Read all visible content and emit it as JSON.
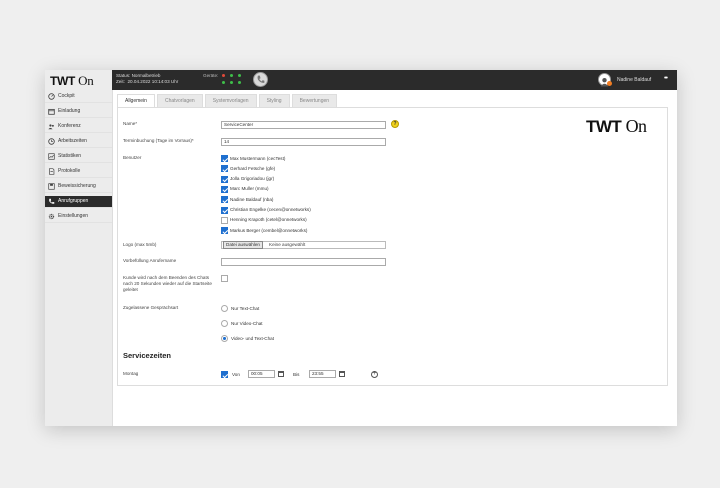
{
  "sidebar": {
    "logo_main": "TWT",
    "logo_suffix": "On",
    "items": [
      {
        "label": "Cockpit",
        "icon": "dashboard-icon"
      },
      {
        "label": "Einladung",
        "icon": "calendar-icon"
      },
      {
        "label": "Konferenz",
        "icon": "people-icon"
      },
      {
        "label": "Arbeitszeiten",
        "icon": "clock-icon"
      },
      {
        "label": "Statistiken",
        "icon": "chart-icon"
      },
      {
        "label": "Protokolle",
        "icon": "log-icon"
      },
      {
        "label": "Beweissicherung",
        "icon": "save-icon"
      },
      {
        "label": "Anrufgruppen",
        "icon": "phone-icon",
        "active": true
      },
      {
        "label": "Einstellungen",
        "icon": "gear-icon"
      }
    ]
  },
  "topbar": {
    "status_label": "Status:",
    "status_value": "Normalbetrieb",
    "time_label": "Zeit:",
    "time_value": "20.04.2022 10:14:03 Uhr",
    "devices_label": "Geräte:",
    "user_name": "Nadine Baldauf",
    "more": "••"
  },
  "tabs": [
    "Allgemein",
    "Chatvorlagen",
    "Systemvorlagen",
    "Styling",
    "Bewertungen"
  ],
  "form": {
    "name_label": "Name*",
    "name_value": "ServiceCenter",
    "booking_label": "Terminbuchung (Tage im Vorraus)*",
    "booking_value": "14",
    "users_label": "Benutzer",
    "users": [
      {
        "name": "Max Mustermann (cecTest)",
        "checked": true
      },
      {
        "name": "Gerhard Fetsche (gfe)",
        "checked": true
      },
      {
        "name": "Jolla Grigoriadou (jgr)",
        "checked": true
      },
      {
        "name": "Marc Muller (mmu)",
        "checked": true
      },
      {
        "name": "Nadine Baldauf (nba)",
        "checked": true
      },
      {
        "name": "Christian Engelke (cecen@onnetworks)",
        "checked": true
      },
      {
        "name": "Henning Krapoth (cetel@onnetworks)",
        "checked": false
      },
      {
        "name": "Markus Berger (cembel@onnetworks)",
        "checked": true
      }
    ],
    "logo_label": "Logo (max 5mb)",
    "file_button": "Datei auswählen",
    "file_status": "Keine ausgewählt",
    "prefill_label": "Vorbefüllung Anrufername",
    "prefill_value": "",
    "redirect_label": "Kunde wird nach dem Beenden des Chats nach 20 Sekunden wieder auf die Startseite geleitet",
    "conversation_label": "Zugelassene Gesprächsart",
    "radio_options": [
      {
        "label": "Nur Text-Chat",
        "selected": false
      },
      {
        "label": "Nur Video-Chat",
        "selected": false
      },
      {
        "label": "Video- und Text-Chat",
        "selected": true
      }
    ],
    "help_glyph": "?"
  },
  "brand": {
    "main": "TWT",
    "suffix": "On"
  },
  "service": {
    "heading": "Servicezeiten",
    "day_label": "Montag",
    "from_label": "Von",
    "from_value": "00:05",
    "to_label": "Bis",
    "to_value": "23:55",
    "add_glyph": "+"
  }
}
